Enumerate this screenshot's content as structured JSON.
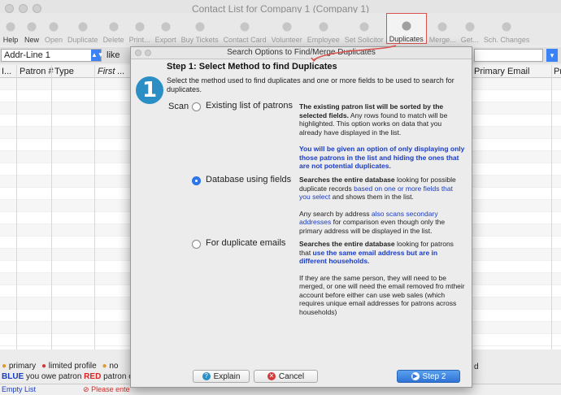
{
  "window": {
    "title": "Contact List for Company 1 (Company 1)"
  },
  "toolbar": {
    "items": [
      {
        "label": "Help",
        "icon": "help-icon"
      },
      {
        "label": "New",
        "icon": "new-icon"
      },
      {
        "label": "Open",
        "icon": "open-icon"
      },
      {
        "label": "Duplicate",
        "icon": "duplicate-icon"
      },
      {
        "label": "Delete",
        "icon": "trash-icon"
      },
      {
        "label": "Print...",
        "icon": "print-icon"
      },
      {
        "label": "Export",
        "icon": "export-icon"
      },
      {
        "label": "Buy Tickets",
        "icon": "ticket-icon"
      },
      {
        "label": "Contact Card",
        "icon": "contact-card-icon"
      },
      {
        "label": "Volunteer",
        "icon": "volunteer-icon"
      },
      {
        "label": "Employee",
        "icon": "employee-icon"
      },
      {
        "label": "Set Solicitor",
        "icon": "solicitor-icon"
      },
      {
        "label": "Duplicates",
        "icon": "duplicates-icon"
      },
      {
        "label": "Merge...",
        "icon": "merge-icon"
      },
      {
        "label": "Get...",
        "icon": "get-icon"
      },
      {
        "label": "Sch. Changes",
        "icon": "schedule-icon"
      }
    ]
  },
  "filter": {
    "field_value": "Addr-Line 1",
    "operator_label": "like"
  },
  "grid": {
    "columns": [
      "I...",
      "Patron #",
      "Type",
      "First ...",
      "Primary Email",
      "Pr"
    ]
  },
  "legend": {
    "row1": [
      "primary",
      "limited profile",
      "no"
    ],
    "row2_blue": "BLUE",
    "row2_mid": " you owe patron ",
    "row2_red": "RED",
    "row2_end": " patron o",
    "right_fragment": "d"
  },
  "status": {
    "left": "Empty List",
    "right": "Please ente"
  },
  "dialog": {
    "title": "Search Options to Find/Merge Duplicates",
    "step_title": "Step 1: Select Method to find Duplicates",
    "description": "Select the method used to find duplicates and one or more fields to be used to search for duplicates.",
    "badge": "1",
    "scan_label": "Scan",
    "options": [
      {
        "label": "Existing list of patrons",
        "selected": false,
        "desc_bold": "The existing patron list will be sorted by the selected fields.",
        "desc_text": " Any rows found to match will be highlighted.  This option works on data that you already have displayed in the list.",
        "desc_blue": "You will be given an option of only displaying only those patrons in the list and hiding the ones that are not potential duplicates."
      },
      {
        "label": "Database using fields",
        "selected": true,
        "desc_bold": "Searches the entire database",
        "desc_text1": " looking for possible duplicate records ",
        "desc_blue1": "based on one or more fields that you select",
        "desc_text2": " and shows them in the list.",
        "desc_text3": "Any search by address ",
        "desc_blue2": "also scans secondary addresses",
        "desc_text4": " for comparison even though only the primary address will be displayed in the list."
      },
      {
        "label": "For duplicate emails",
        "selected": false,
        "desc_bold": "Searches the entire database",
        "desc_text1": " looking for patrons that ",
        "desc_blue1": "use the same email address but are in different households.",
        "desc_text2": "If they are the same person, they will need to be merged, or one will need the email removed fro mtheir account before either can use web sales (which requires unique email addresses for patrons across households)"
      }
    ],
    "buttons": {
      "explain": "Explain",
      "cancel": "Cancel",
      "next": "Step 2"
    }
  },
  "colors": {
    "accent": "#2a78f0",
    "highlight_border": "#d9534f",
    "info_blue": "#1a3cc4"
  }
}
